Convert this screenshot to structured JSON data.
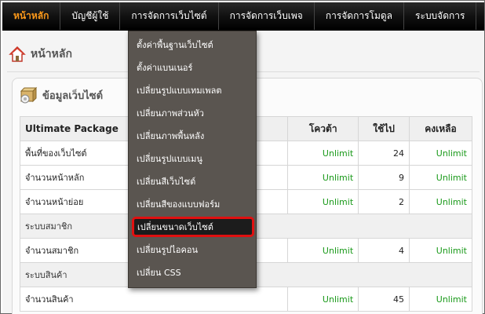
{
  "nav": {
    "items": [
      {
        "label": "หน้าหลัก",
        "active": true
      },
      {
        "label": "บัญชีผู้ใช้",
        "active": false
      },
      {
        "label": "การจัดการเว็บไซต์",
        "active": false
      },
      {
        "label": "การจัดการเว็บเพจ",
        "active": false
      },
      {
        "label": "การจัดการโมดูล",
        "active": false
      },
      {
        "label": "ระบบจัดการ",
        "active": false
      }
    ],
    "active_color": "#ff9a1a"
  },
  "page": {
    "title": "หน้าหลัก",
    "title_icon": "home-icon"
  },
  "panel": {
    "title": "ข้อมูลเว็บไซต์",
    "title_icon": "package-box-icon"
  },
  "table": {
    "headers": {
      "name": "Ultimate Package",
      "quota": "โควต้า",
      "used": "ใช้ไป",
      "left": "คงเหลือ"
    },
    "rows": [
      {
        "name": "พื้นที่ของเว็บไซต์",
        "quota": "Unlimit",
        "used": "24",
        "left": "Unlimit"
      },
      {
        "name": "จำนวนหน้าหลัก",
        "quota": "Unlimit",
        "used": "9",
        "left": "Unlimit"
      },
      {
        "name": "จำนวนหน้าย่อย",
        "quota": "Unlimit",
        "used": "2",
        "left": "Unlimit"
      },
      {
        "section": "ระบบสมาชิก"
      },
      {
        "name": "จำนวนสมาชิก",
        "quota": "Unlimit",
        "used": "4",
        "left": "Unlimit"
      },
      {
        "section": "ระบบสินค้า"
      },
      {
        "name": "จำนวนสินค้า",
        "quota": "Unlimit",
        "used": "45",
        "left": "Unlimit"
      }
    ],
    "value_color": "#1a9a1a"
  },
  "dropdown": {
    "items": [
      {
        "label": "ตั้งค่าพื้นฐานเว็บไซต์",
        "highlighted": false
      },
      {
        "label": "ตั้งค่าแบนเนอร์",
        "highlighted": false
      },
      {
        "label": "เปลี่ยนรูปแบบเทมเพลต",
        "highlighted": false
      },
      {
        "label": "เปลี่ยนภาพส่วนหัว",
        "highlighted": false
      },
      {
        "label": "เปลี่ยนภาพพื้นหลัง",
        "highlighted": false
      },
      {
        "label": "เปลี่ยนรูปแบบเมนู",
        "highlighted": false
      },
      {
        "label": "เปลี่ยนสีเว็บไซต์",
        "highlighted": false
      },
      {
        "label": "เปลี่ยนสีของแบบฟอร์ม",
        "highlighted": false
      },
      {
        "label": "เปลี่ยนขนาดเว็บไซต์",
        "highlighted": true
      },
      {
        "label": "เปลี่ยนรูปไอคอน",
        "highlighted": false
      },
      {
        "label": "เปลี่ยน CSS",
        "highlighted": false
      }
    ],
    "highlight_color": "#e01010"
  }
}
